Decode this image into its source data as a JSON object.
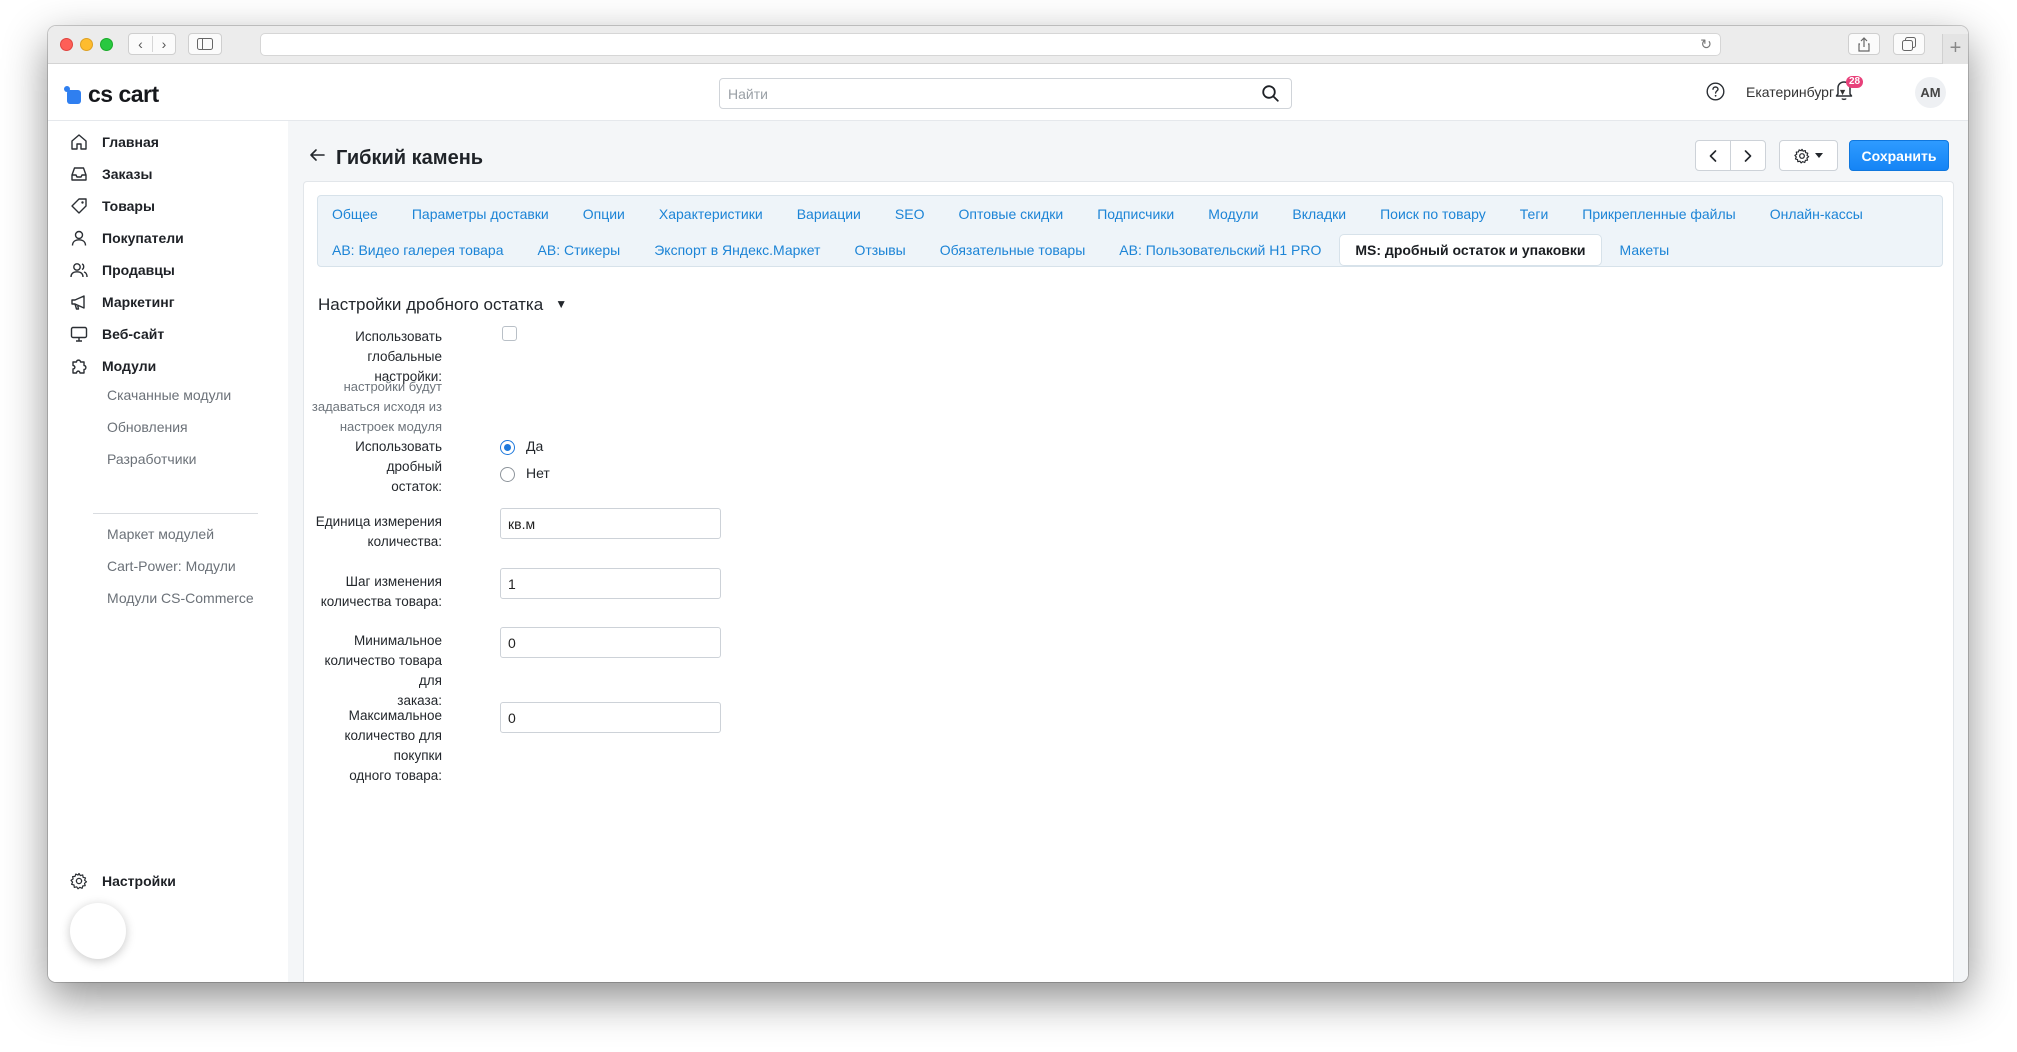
{
  "app": {
    "logo_text": "cs cart"
  },
  "search": {
    "placeholder": "Найти"
  },
  "header": {
    "city": "Екатеринбург",
    "notification_count": "28",
    "avatar_initials": "AM"
  },
  "sidebar": {
    "items": [
      {
        "label": "Главная",
        "icon": "home-icon"
      },
      {
        "label": "Заказы",
        "icon": "inbox-icon"
      },
      {
        "label": "Товары",
        "icon": "tag-icon"
      },
      {
        "label": "Покупатели",
        "icon": "user-icon"
      },
      {
        "label": "Продавцы",
        "icon": "users-icon"
      },
      {
        "label": "Маркетинг",
        "icon": "megaphone-icon"
      },
      {
        "label": "Веб-сайт",
        "icon": "monitor-icon"
      },
      {
        "label": "Модули",
        "icon": "puzzle-icon"
      }
    ],
    "sub_items": [
      "Скачанные модули",
      "Обновления",
      "Разработчики"
    ],
    "market_items": [
      "Маркет модулей",
      "Cart-Power: Модули",
      "Модули CS-Commerce"
    ],
    "settings_label": "Настройки"
  },
  "page": {
    "title": "Гибкий камень",
    "save_label": "Сохранить"
  },
  "tabs": {
    "row1": [
      "Общее",
      "Параметры доставки",
      "Опции",
      "Характеристики",
      "Вариации",
      "SEO",
      "Оптовые скидки",
      "Подписчики",
      "Модули",
      "Вкладки",
      "Поиск по товару",
      "Теги",
      "Прикрепленные файлы",
      "Онлайн-кассы"
    ],
    "row2": [
      "AB: Видео галерея товара",
      "AB: Стикеры",
      "Экспорт в Яндекс.Маркет",
      "Отзывы",
      "Обязательные товары",
      "AB: Пользовательский H1 PRO",
      "MS: дробный остаток и упаковки",
      "Макеты"
    ],
    "active": "MS: дробный остаток и упаковки"
  },
  "form": {
    "section_title": "Настройки дробного остатка",
    "global": {
      "label_line1": "Использовать",
      "label_line2": "глобальные настройки:",
      "hint_line1": "настройки будут",
      "hint_line2": "задаваться исходя из",
      "hint_line3": "настроек модуля",
      "checked": false
    },
    "fractional": {
      "label_line1": "Использовать дробный",
      "label_line2": "остаток:",
      "option_yes": "Да",
      "option_no": "Нет",
      "selected": "Да"
    },
    "unit": {
      "label_line1": "Единица измерения",
      "label_line2": "количества:",
      "value": "кв.м"
    },
    "step": {
      "label_line1": "Шаг изменения",
      "label_line2": "количества товара:",
      "value": "1"
    },
    "min_qty": {
      "label_line1": "Минимальное",
      "label_line2": "количество товара для",
      "label_line3": "заказа:",
      "value": "0"
    },
    "max_qty": {
      "label_line1": "Максимальное",
      "label_line2": "количество для покупки",
      "label_line3": "одного товара:",
      "value": "0"
    }
  },
  "colors": {
    "accent": "#1e90ff",
    "link": "#1c84d6",
    "badge": "#e8407a"
  }
}
